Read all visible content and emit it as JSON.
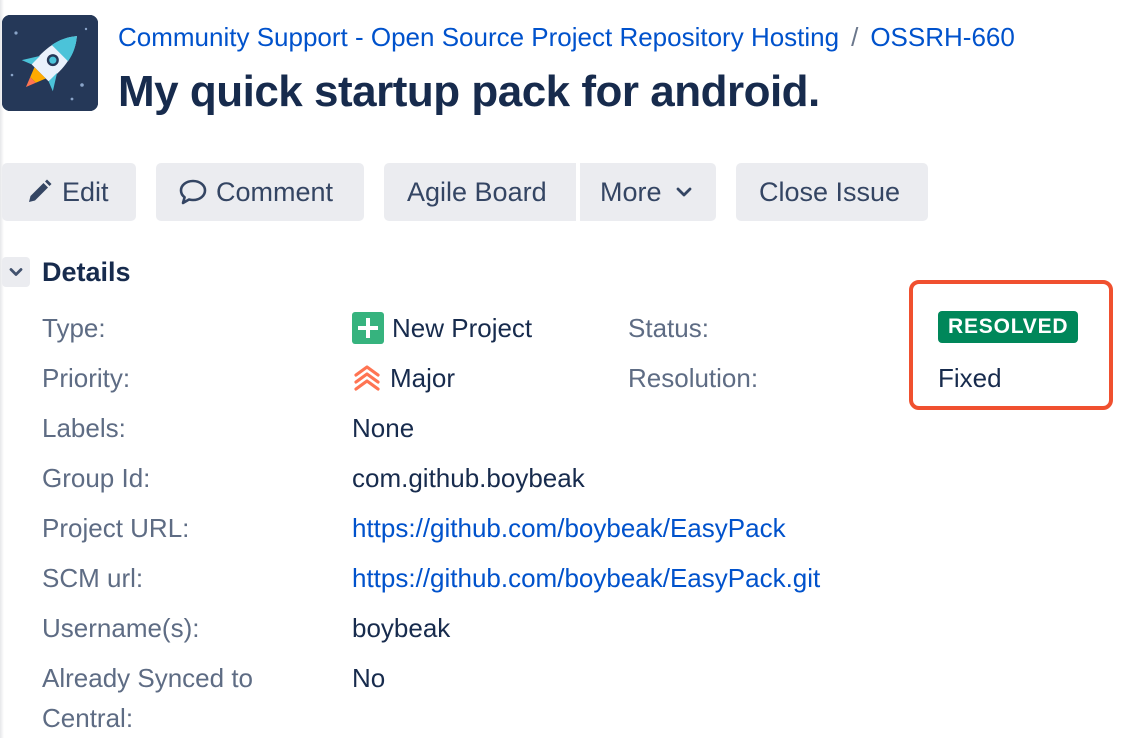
{
  "header": {
    "breadcrumb": {
      "project": "Community Support - Open Source Project Repository Hosting",
      "separator": "/",
      "issue_key": "OSSRH-660"
    },
    "title": "My quick startup pack for android."
  },
  "toolbar": {
    "edit_label": "Edit",
    "comment_label": "Comment",
    "agile_board_label": "Agile Board",
    "more_label": "More",
    "close_issue_label": "Close Issue"
  },
  "details": {
    "section_title": "Details",
    "type": {
      "label": "Type:",
      "value": "New Project",
      "icon": "new-project-icon"
    },
    "priority": {
      "label": "Priority:",
      "value": "Major",
      "icon": "priority-major-icon"
    },
    "labels": {
      "label": "Labels:",
      "value": "None"
    },
    "group_id": {
      "label": "Group Id:",
      "value": "com.github.boybeak"
    },
    "project_url": {
      "label": "Project URL:",
      "value": "https://github.com/boybeak/EasyPack"
    },
    "scm_url": {
      "label": "SCM url:",
      "value": "https://github.com/boybeak/EasyPack.git"
    },
    "usernames": {
      "label": "Username(s):",
      "value": "boybeak"
    },
    "already_synced": {
      "label_line1": "Already Synced to",
      "label_line2": "Central:",
      "value": "No"
    },
    "status": {
      "label": "Status:",
      "value": "RESOLVED"
    },
    "resolution": {
      "label": "Resolution:",
      "value": "Fixed"
    }
  },
  "colors": {
    "link": "#0052cc",
    "text": "#172b4d",
    "muted": "#5e6c84",
    "button_bg": "#ebecf0",
    "status_resolved": "#00875a",
    "new_project_icon": "#36b37e",
    "priority_major": "#ff7452",
    "highlight": "#f0502f",
    "avatar_bg": "#253858"
  }
}
